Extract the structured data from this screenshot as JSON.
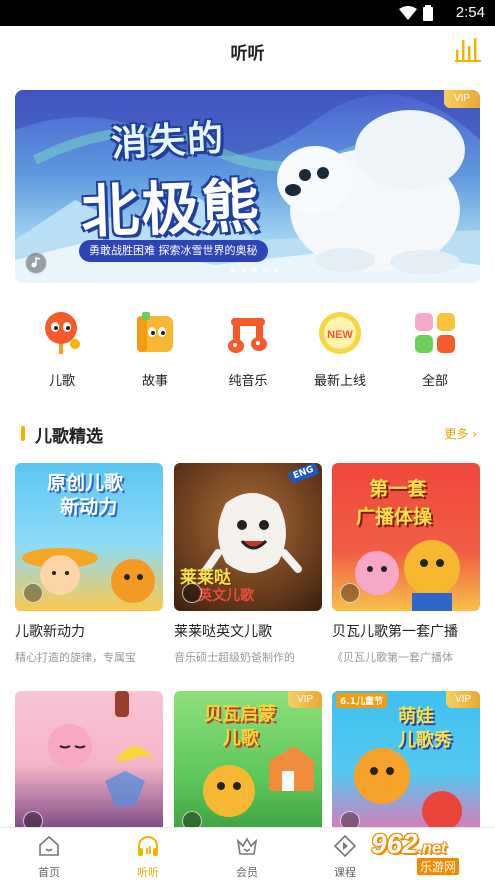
{
  "status_bar": {
    "time": "2:54"
  },
  "header": {
    "title": "听听",
    "action_icon": "equalizer-icon"
  },
  "banner": {
    "vip": "VIP",
    "title_line1": "消失的",
    "title_line2": "北极熊",
    "subtitle": "勇敢战胜困难  探索冰雪世界的奥秘",
    "dots": 5,
    "active_dot": 2
  },
  "categories": [
    {
      "label": "儿歌",
      "icon": "lollipop-mascot-icon"
    },
    {
      "label": "故事",
      "icon": "book-mascot-icon"
    },
    {
      "label": "纯音乐",
      "icon": "music-note-icon"
    },
    {
      "label": "最新上线",
      "icon": "new-badge-icon"
    },
    {
      "label": "全部",
      "icon": "grid-icon"
    }
  ],
  "section": {
    "title": "儿歌精选",
    "more": "更多"
  },
  "albums": [
    {
      "name": "儿歌新动力",
      "desc": "精心打造的旋律，专属宝",
      "cover_title": "原创儿歌\n新动力",
      "vip": ""
    },
    {
      "name": "莱莱哒英文儿歌",
      "desc": "音乐硕士超级奶爸制作的",
      "cover_title": "莱莱哒",
      "cover_sub": "英文儿歌",
      "cover_badge": "ENG",
      "vip": ""
    },
    {
      "name": "贝瓦儿歌第一套广播",
      "desc": "《贝瓦儿歌第一套广播体",
      "cover_title": "第一套\n广播体操",
      "vip": ""
    },
    {
      "name": "",
      "desc": "",
      "cover_title": "",
      "vip": ""
    },
    {
      "name": "",
      "desc": "",
      "cover_title": "贝瓦启蒙\n儿歌",
      "vip": "VIP"
    },
    {
      "name": "",
      "desc": "",
      "cover_title": "萌娃\n儿歌秀",
      "cover_badge": "6.1儿童节",
      "vip": "VIP"
    }
  ],
  "tabs": [
    {
      "label": "首页",
      "icon": "home-icon",
      "active": false
    },
    {
      "label": "听听",
      "icon": "headphones-icon",
      "active": true
    },
    {
      "label": "会员",
      "icon": "crown-icon",
      "active": false
    },
    {
      "label": "课程",
      "icon": "play-diamond-icon",
      "active": false
    }
  ],
  "watermark": {
    "number": "962",
    "suffix": ".net",
    "site": "乐游网"
  }
}
